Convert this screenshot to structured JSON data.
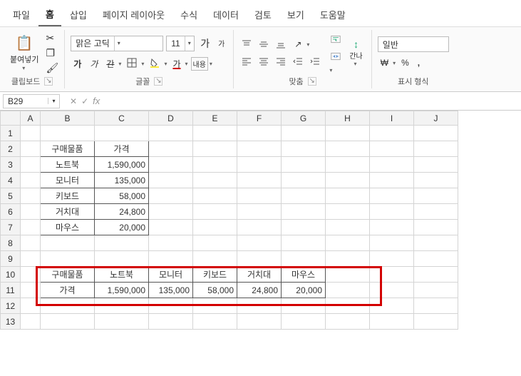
{
  "menu": {
    "items": [
      "파일",
      "홈",
      "삽입",
      "페이지 레이아웃",
      "수식",
      "데이터",
      "검토",
      "보기",
      "도움말"
    ],
    "active_index": 1
  },
  "ribbon": {
    "clipboard": {
      "paste": "붙여넣기",
      "label": "클립보드"
    },
    "font": {
      "name": "맑은 고딕",
      "size": "11",
      "grow": "가",
      "shrink": "가",
      "bold": "가",
      "italic": "가",
      "strike": "간",
      "underline": "가",
      "label": "글꼴"
    },
    "align": {
      "wrap": "내용",
      "label": "맞춤"
    },
    "sort": {
      "label": "간나"
    },
    "number": {
      "format": "일반",
      "currency": "₩",
      "label": "표시 형식"
    }
  },
  "namebox": "B29",
  "fx": "fx",
  "columns": [
    "A",
    "B",
    "C",
    "D",
    "E",
    "F",
    "G",
    "H",
    "I",
    "J"
  ],
  "rows": [
    1,
    2,
    3,
    4,
    5,
    6,
    7,
    8,
    9,
    10,
    11,
    12,
    13
  ],
  "table_vertical": {
    "headers": [
      "구매물품",
      "가격"
    ],
    "rows": [
      [
        "노트북",
        "1,590,000"
      ],
      [
        "모니터",
        "135,000"
      ],
      [
        "키보드",
        "58,000"
      ],
      [
        "거치대",
        "24,800"
      ],
      [
        "마우스",
        "20,000"
      ]
    ]
  },
  "table_horizontal": {
    "row_labels": [
      "구매물품",
      "가격"
    ],
    "cols": [
      [
        "노트북",
        "1,590,000"
      ],
      [
        "모니터",
        "135,000"
      ],
      [
        "키보드",
        "58,000"
      ],
      [
        "거치대",
        "24,800"
      ],
      [
        "마우스",
        "20,000"
      ]
    ]
  }
}
